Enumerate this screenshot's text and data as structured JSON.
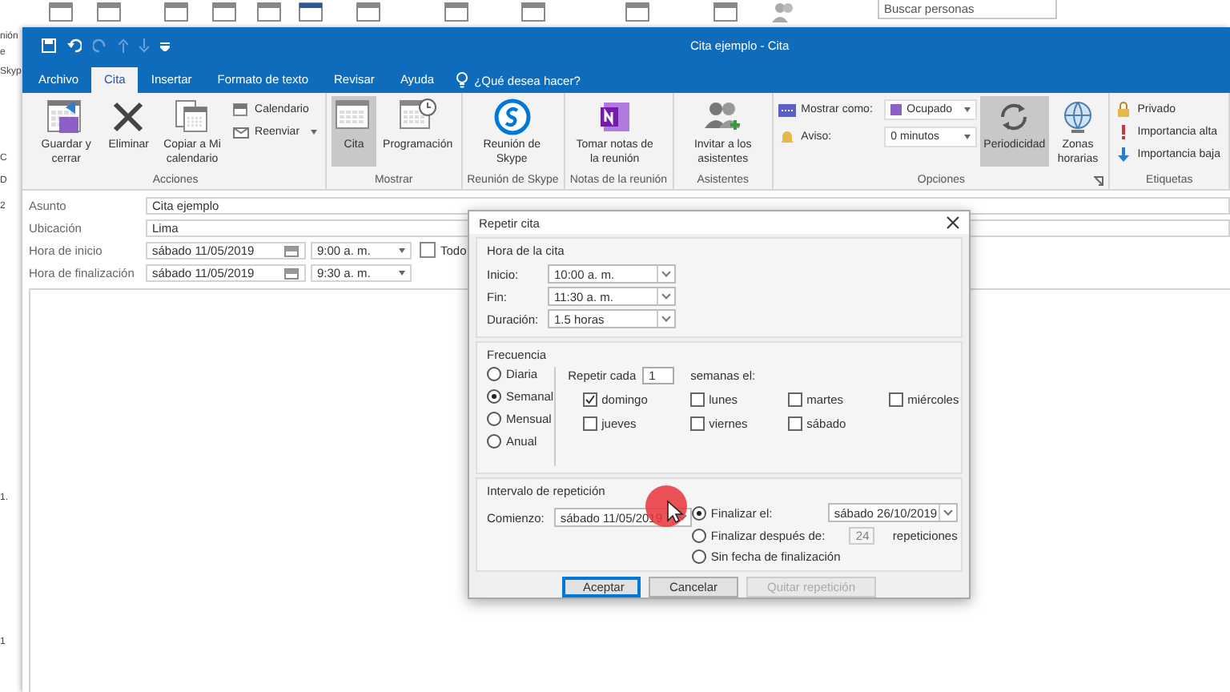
{
  "background": {
    "fragments": [
      "nión",
      "e",
      "Skyp",
      "C",
      "D",
      "2",
      "1.",
      "1"
    ],
    "search": {
      "placeholder": "Buscar personas"
    }
  },
  "window": {
    "title": "Cita ejemplo  -  Cita"
  },
  "tabs": [
    {
      "label": "Archivo",
      "selected": false
    },
    {
      "label": "Cita",
      "selected": true
    },
    {
      "label": "Insertar",
      "selected": false
    },
    {
      "label": "Formato de texto",
      "selected": false
    },
    {
      "label": "Revisar",
      "selected": false
    },
    {
      "label": "Ayuda",
      "selected": false
    }
  ],
  "tell_me": {
    "label": "¿Qué desea hacer?"
  },
  "ribbon": {
    "groups": [
      {
        "label": "Acciones",
        "items": [
          {
            "kind": "large",
            "label": "Guardar y cerrar",
            "selected": false
          },
          {
            "kind": "large",
            "label": "Eliminar",
            "selected": false
          },
          {
            "kind": "large",
            "label": "Copiar a Mi calendario",
            "selected": false
          },
          {
            "kind": "stack",
            "items": [
              {
                "label": "Calendario"
              },
              {
                "label": "Reenviar",
                "dropdown": true
              }
            ]
          }
        ]
      },
      {
        "label": "Mostrar",
        "items": [
          {
            "kind": "large",
            "label": "Cita",
            "selected": true
          },
          {
            "kind": "large",
            "label": "Programación",
            "selected": false
          }
        ]
      },
      {
        "label": "Reunión de Skype",
        "items": [
          {
            "kind": "large",
            "label": "Reunión de Skype",
            "selected": false
          }
        ]
      },
      {
        "label": "Notas de la reunión",
        "items": [
          {
            "kind": "large",
            "label": "Tomar notas de la reunión",
            "selected": false
          }
        ]
      },
      {
        "label": "Asistentes",
        "items": [
          {
            "kind": "large",
            "label": "Invitar a los asistentes",
            "selected": false
          }
        ]
      },
      {
        "label": "Opciones",
        "launcher": true,
        "items": [
          {
            "kind": "fields",
            "rows": [
              {
                "label": "Mostrar como:",
                "value": "Ocupado"
              },
              {
                "label": "Aviso:",
                "value": "0 minutos"
              }
            ]
          },
          {
            "kind": "large",
            "label": "Periodicidad",
            "selected": true
          },
          {
            "kind": "large",
            "label": "Zonas horarias",
            "selected": false
          }
        ]
      },
      {
        "label": "Etiquetas",
        "items": [
          {
            "kind": "stack",
            "items": [
              {
                "label": "Privado"
              },
              {
                "label": "Importancia alta"
              },
              {
                "label": "Importancia baja"
              }
            ]
          }
        ]
      }
    ]
  },
  "form": {
    "rows": [
      {
        "kind": "text",
        "label": "Asunto",
        "value": "Cita ejemplo"
      },
      {
        "kind": "text",
        "label": "Ubicación",
        "value": "Lima"
      },
      {
        "kind": "datetime",
        "label": "Hora de inicio",
        "date": "sábado 11/05/2019",
        "time": "9:00 a. m.",
        "all_day": {
          "label": "Todo",
          "checked": false
        }
      },
      {
        "kind": "datetime",
        "label": "Hora de finalización",
        "date": "sábado 11/05/2019",
        "time": "9:30 a. m."
      }
    ]
  },
  "dialog": {
    "title": "Repetir cita",
    "time": {
      "heading": "Hora de la cita",
      "fields": [
        {
          "label": "Inicio:",
          "value": "10:00 a. m."
        },
        {
          "label": "Fin:",
          "value": "11:30 a. m."
        },
        {
          "label": "Duración:",
          "value": "1.5 horas"
        }
      ]
    },
    "frequency": {
      "heading": "Frecuencia",
      "options": [
        {
          "label": "Diaria",
          "selected": false
        },
        {
          "label": "Semanal",
          "selected": true
        },
        {
          "label": "Mensual",
          "selected": false
        },
        {
          "label": "Anual",
          "selected": false
        }
      ],
      "repeat_label": "Repetir cada",
      "repeat_value": "1",
      "unit_label": "semanas el:",
      "days": [
        {
          "label": "domingo",
          "checked": true
        },
        {
          "label": "lunes",
          "checked": false
        },
        {
          "label": "martes",
          "checked": false
        },
        {
          "label": "miércoles",
          "checked": false
        },
        {
          "label": "jueves",
          "checked": false
        },
        {
          "label": "viernes",
          "checked": false
        },
        {
          "label": "sábado",
          "checked": false
        }
      ]
    },
    "range": {
      "heading": "Intervalo de repetición",
      "start_label": "Comienzo:",
      "start_value": "sábado 11/05/2019",
      "end_options": [
        {
          "kind": "date",
          "label": "Finalizar el:",
          "selected": true,
          "value": "sábado 26/10/2019"
        },
        {
          "kind": "count",
          "label": "Finalizar después de:",
          "selected": false,
          "value": "24",
          "suffix": "repeticiones"
        },
        {
          "kind": "none",
          "label": "Sin fecha de finalización",
          "selected": false
        }
      ]
    },
    "buttons": [
      {
        "label": "Aceptar",
        "default": true,
        "disabled": false
      },
      {
        "label": "Cancelar",
        "default": false,
        "disabled": false
      },
      {
        "label": "Quitar repetición",
        "default": false,
        "disabled": true
      }
    ]
  }
}
